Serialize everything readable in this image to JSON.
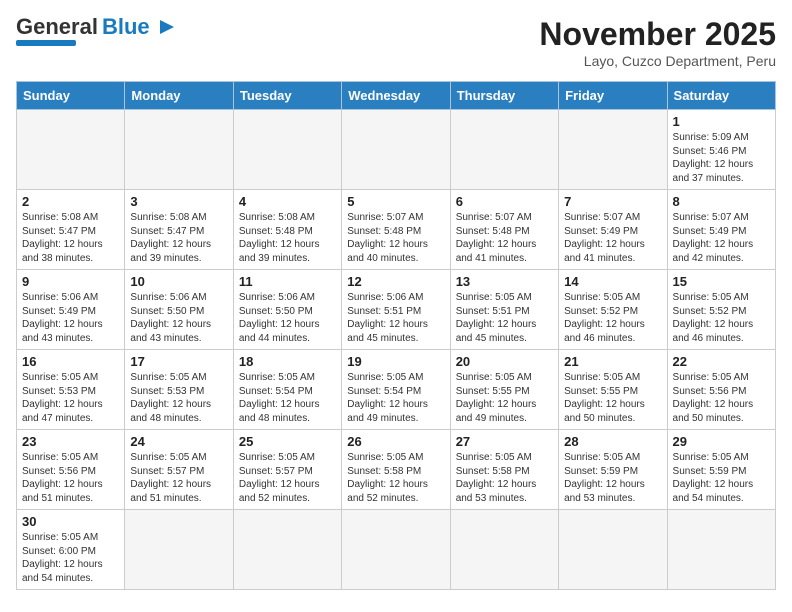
{
  "logo": {
    "general": "General",
    "blue": "Blue"
  },
  "header": {
    "month": "November 2025",
    "location": "Layo, Cuzco Department, Peru"
  },
  "days_of_week": [
    "Sunday",
    "Monday",
    "Tuesday",
    "Wednesday",
    "Thursday",
    "Friday",
    "Saturday"
  ],
  "weeks": [
    [
      {
        "day": "",
        "info": ""
      },
      {
        "day": "",
        "info": ""
      },
      {
        "day": "",
        "info": ""
      },
      {
        "day": "",
        "info": ""
      },
      {
        "day": "",
        "info": ""
      },
      {
        "day": "",
        "info": ""
      },
      {
        "day": "1",
        "info": "Sunrise: 5:09 AM\nSunset: 5:46 PM\nDaylight: 12 hours and 37 minutes."
      }
    ],
    [
      {
        "day": "2",
        "info": "Sunrise: 5:08 AM\nSunset: 5:47 PM\nDaylight: 12 hours and 38 minutes."
      },
      {
        "day": "3",
        "info": "Sunrise: 5:08 AM\nSunset: 5:47 PM\nDaylight: 12 hours and 39 minutes."
      },
      {
        "day": "4",
        "info": "Sunrise: 5:08 AM\nSunset: 5:48 PM\nDaylight: 12 hours and 39 minutes."
      },
      {
        "day": "5",
        "info": "Sunrise: 5:07 AM\nSunset: 5:48 PM\nDaylight: 12 hours and 40 minutes."
      },
      {
        "day": "6",
        "info": "Sunrise: 5:07 AM\nSunset: 5:48 PM\nDaylight: 12 hours and 41 minutes."
      },
      {
        "day": "7",
        "info": "Sunrise: 5:07 AM\nSunset: 5:49 PM\nDaylight: 12 hours and 41 minutes."
      },
      {
        "day": "8",
        "info": "Sunrise: 5:07 AM\nSunset: 5:49 PM\nDaylight: 12 hours and 42 minutes."
      }
    ],
    [
      {
        "day": "9",
        "info": "Sunrise: 5:06 AM\nSunset: 5:49 PM\nDaylight: 12 hours and 43 minutes."
      },
      {
        "day": "10",
        "info": "Sunrise: 5:06 AM\nSunset: 5:50 PM\nDaylight: 12 hours and 43 minutes."
      },
      {
        "day": "11",
        "info": "Sunrise: 5:06 AM\nSunset: 5:50 PM\nDaylight: 12 hours and 44 minutes."
      },
      {
        "day": "12",
        "info": "Sunrise: 5:06 AM\nSunset: 5:51 PM\nDaylight: 12 hours and 45 minutes."
      },
      {
        "day": "13",
        "info": "Sunrise: 5:05 AM\nSunset: 5:51 PM\nDaylight: 12 hours and 45 minutes."
      },
      {
        "day": "14",
        "info": "Sunrise: 5:05 AM\nSunset: 5:52 PM\nDaylight: 12 hours and 46 minutes."
      },
      {
        "day": "15",
        "info": "Sunrise: 5:05 AM\nSunset: 5:52 PM\nDaylight: 12 hours and 46 minutes."
      }
    ],
    [
      {
        "day": "16",
        "info": "Sunrise: 5:05 AM\nSunset: 5:53 PM\nDaylight: 12 hours and 47 minutes."
      },
      {
        "day": "17",
        "info": "Sunrise: 5:05 AM\nSunset: 5:53 PM\nDaylight: 12 hours and 48 minutes."
      },
      {
        "day": "18",
        "info": "Sunrise: 5:05 AM\nSunset: 5:54 PM\nDaylight: 12 hours and 48 minutes."
      },
      {
        "day": "19",
        "info": "Sunrise: 5:05 AM\nSunset: 5:54 PM\nDaylight: 12 hours and 49 minutes."
      },
      {
        "day": "20",
        "info": "Sunrise: 5:05 AM\nSunset: 5:55 PM\nDaylight: 12 hours and 49 minutes."
      },
      {
        "day": "21",
        "info": "Sunrise: 5:05 AM\nSunset: 5:55 PM\nDaylight: 12 hours and 50 minutes."
      },
      {
        "day": "22",
        "info": "Sunrise: 5:05 AM\nSunset: 5:56 PM\nDaylight: 12 hours and 50 minutes."
      }
    ],
    [
      {
        "day": "23",
        "info": "Sunrise: 5:05 AM\nSunset: 5:56 PM\nDaylight: 12 hours and 51 minutes."
      },
      {
        "day": "24",
        "info": "Sunrise: 5:05 AM\nSunset: 5:57 PM\nDaylight: 12 hours and 51 minutes."
      },
      {
        "day": "25",
        "info": "Sunrise: 5:05 AM\nSunset: 5:57 PM\nDaylight: 12 hours and 52 minutes."
      },
      {
        "day": "26",
        "info": "Sunrise: 5:05 AM\nSunset: 5:58 PM\nDaylight: 12 hours and 52 minutes."
      },
      {
        "day": "27",
        "info": "Sunrise: 5:05 AM\nSunset: 5:58 PM\nDaylight: 12 hours and 53 minutes."
      },
      {
        "day": "28",
        "info": "Sunrise: 5:05 AM\nSunset: 5:59 PM\nDaylight: 12 hours and 53 minutes."
      },
      {
        "day": "29",
        "info": "Sunrise: 5:05 AM\nSunset: 5:59 PM\nDaylight: 12 hours and 54 minutes."
      }
    ],
    [
      {
        "day": "30",
        "info": "Sunrise: 5:05 AM\nSunset: 6:00 PM\nDaylight: 12 hours and 54 minutes."
      },
      {
        "day": "",
        "info": ""
      },
      {
        "day": "",
        "info": ""
      },
      {
        "day": "",
        "info": ""
      },
      {
        "day": "",
        "info": ""
      },
      {
        "day": "",
        "info": ""
      },
      {
        "day": "",
        "info": ""
      }
    ]
  ]
}
